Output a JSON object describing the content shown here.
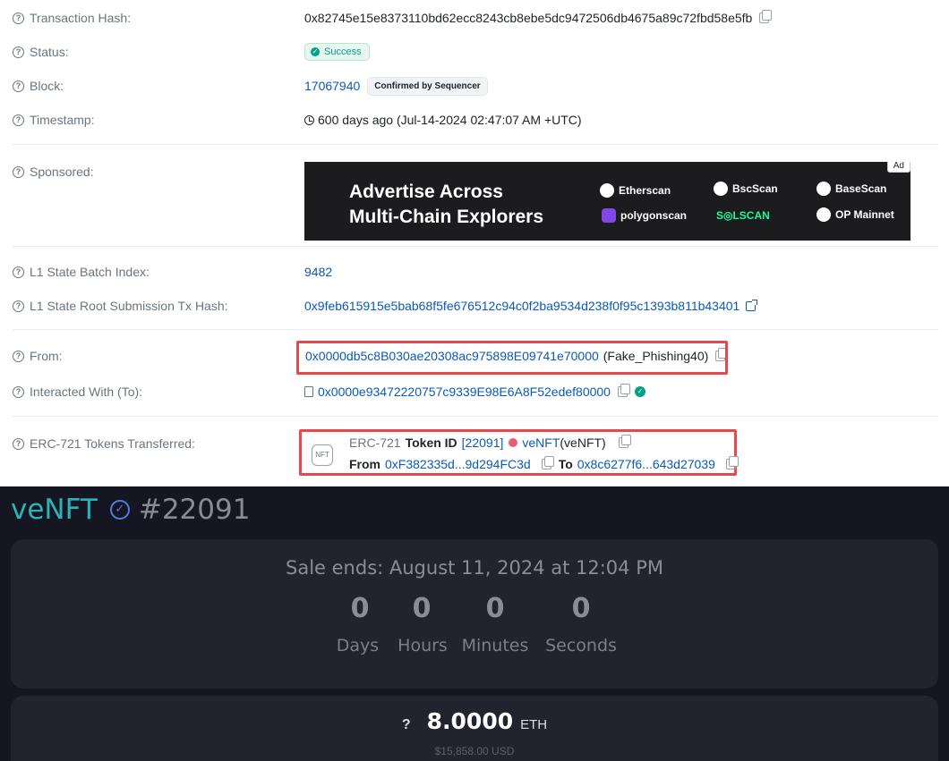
{
  "explorer": {
    "transaction_hash": {
      "label": "Transaction Hash:",
      "value": "0x82745e15e8373110bd62ecc8243cb8ebe5dc9472506db4675a89c72fbd58e5fb"
    },
    "status": {
      "label": "Status:",
      "value": "Success"
    },
    "block": {
      "label": "Block:",
      "number": "17067940",
      "badge": "Confirmed by Sequencer"
    },
    "timestamp": {
      "label": "Timestamp:",
      "value": "600 days ago (Jul-14-2024 02:47:07 AM +UTC)"
    },
    "sponsored": {
      "label": "Sponsored:",
      "ad_line1": "Advertise Across",
      "ad_line2": "Multi-Chain Explorers",
      "ad_tag": "Ad",
      "brands": [
        "Etherscan",
        "BscScan",
        "BaseScan",
        "polygonscan",
        "S◎LSCAN",
        "OP Mainnet"
      ]
    },
    "l1_batch": {
      "label": "L1 State Batch Index:",
      "value": "9482"
    },
    "l1_root": {
      "label": "L1 State Root Submission Tx Hash:",
      "value": "0x9feb615915e5bab68f5fe676512c94c0f2ba9534d238f0f95c1393b811b43401"
    },
    "from": {
      "label": "From:",
      "address": "0x0000db5c8B030ae20308ac975898E09741e70000",
      "tag": "(Fake_Phishing40)"
    },
    "to": {
      "label": "Interacted With (To):",
      "address": "0x0000e93472220757c9339E98E6A8F52edef80000"
    },
    "erc721": {
      "label": "ERC-721 Tokens Transferred:",
      "nft_icon": "NFT",
      "standard": "ERC-721",
      "token_id_label": "Token ID",
      "token_id": "[22091]",
      "token_name": "veNFT",
      "token_symbol": "(veNFT)",
      "from_label": "From",
      "from_address": "0xF382335d...9d294FC3d",
      "to_label": "To",
      "to_address": "0x8c6277f6...643d27039"
    }
  },
  "market": {
    "title_name": "veNFT",
    "title_number": "#22091",
    "sale_ends": "Sale ends: August 11, 2024 at 12:04 PM",
    "countdown": [
      {
        "value": "0",
        "label": "Days"
      },
      {
        "value": "0",
        "label": "Hours"
      },
      {
        "value": "0",
        "label": "Minutes"
      },
      {
        "value": "0",
        "label": "Seconds"
      }
    ],
    "price_help": "?",
    "price": "8.0000",
    "currency": "ETH",
    "usd": "$15,858.00  USD"
  },
  "colors": {
    "link": "#0a5ab7",
    "success": "#00a186",
    "highlight_box": "#e5484d",
    "market_bg": "#161622",
    "market_accent": "#2ab3b6"
  }
}
